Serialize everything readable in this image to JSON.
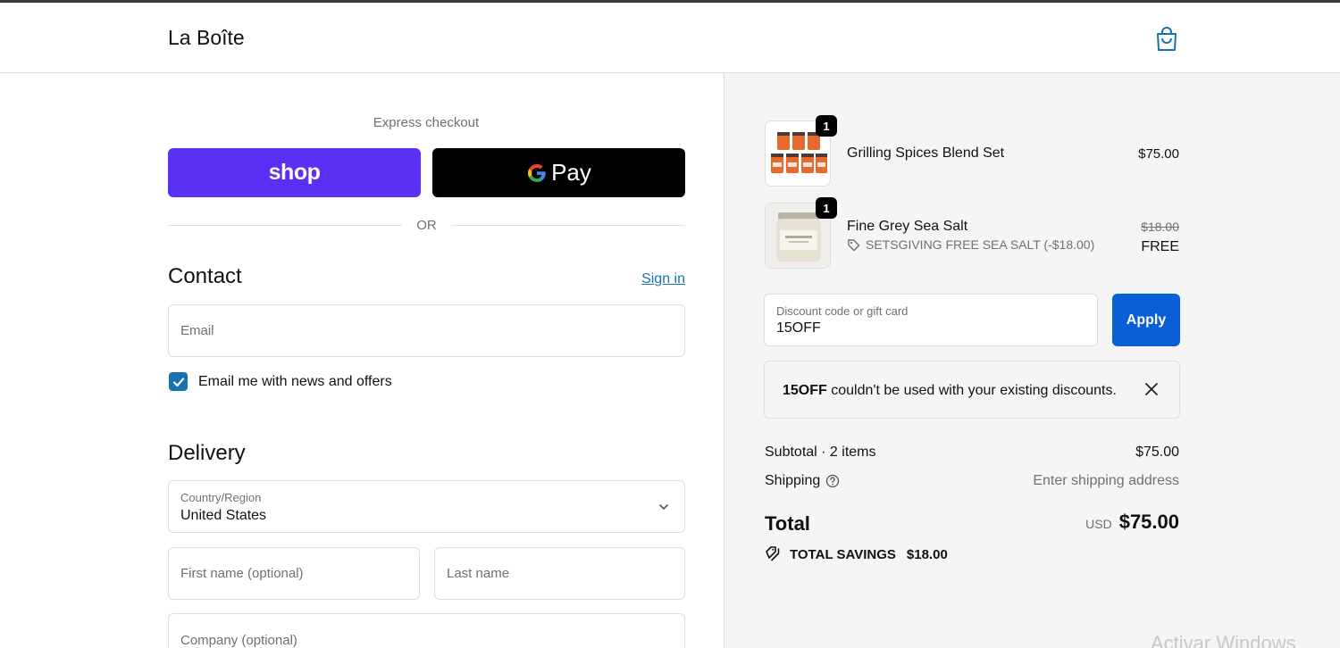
{
  "header": {
    "brand": "La Boîte",
    "cart_icon": "shopping-bag-icon"
  },
  "express": {
    "label": "Express checkout",
    "shop_label": "shop",
    "gpay_g": "G",
    "gpay_label": "Pay",
    "or_label": "OR"
  },
  "contact": {
    "title": "Contact",
    "sign_in": "Sign in",
    "email_placeholder": "Email",
    "newsletter_label": "Email me with news and offers",
    "newsletter_checked": true
  },
  "delivery": {
    "title": "Delivery",
    "country_label": "Country/Region",
    "country_value": "United States",
    "first_name_placeholder": "First name (optional)",
    "last_name_placeholder": "Last name",
    "company_placeholder": "Company (optional)"
  },
  "order": {
    "items": [
      {
        "name": "Grilling Spices Blend Set",
        "quantity": "1",
        "price": "$75.00"
      },
      {
        "name": "Fine Grey Sea Salt",
        "quantity": "1",
        "original_price": "$18.00",
        "price": "FREE",
        "discount": "SETSGIVING FREE SEA SALT (-$18.00)"
      }
    ],
    "discount_field": {
      "label": "Discount code or gift card",
      "value": "15OFF"
    },
    "apply_label": "Apply",
    "notice": {
      "code": "15OFF",
      "message": " couldn't be used with your existing discounts."
    },
    "subtotal_label": "Subtotal · 2 items",
    "subtotal_value": "$75.00",
    "shipping_label": "Shipping",
    "shipping_value": "Enter shipping address",
    "total_label": "Total",
    "currency": "USD",
    "total_value": "$75.00",
    "savings_label": "TOTAL SAVINGS",
    "savings_value": "$18.00"
  },
  "colors": {
    "shop_purple": "#5a31f4",
    "apply_blue": "#0b5fd6",
    "link_blue": "#1773b0"
  },
  "watermark": "Activar Windows"
}
